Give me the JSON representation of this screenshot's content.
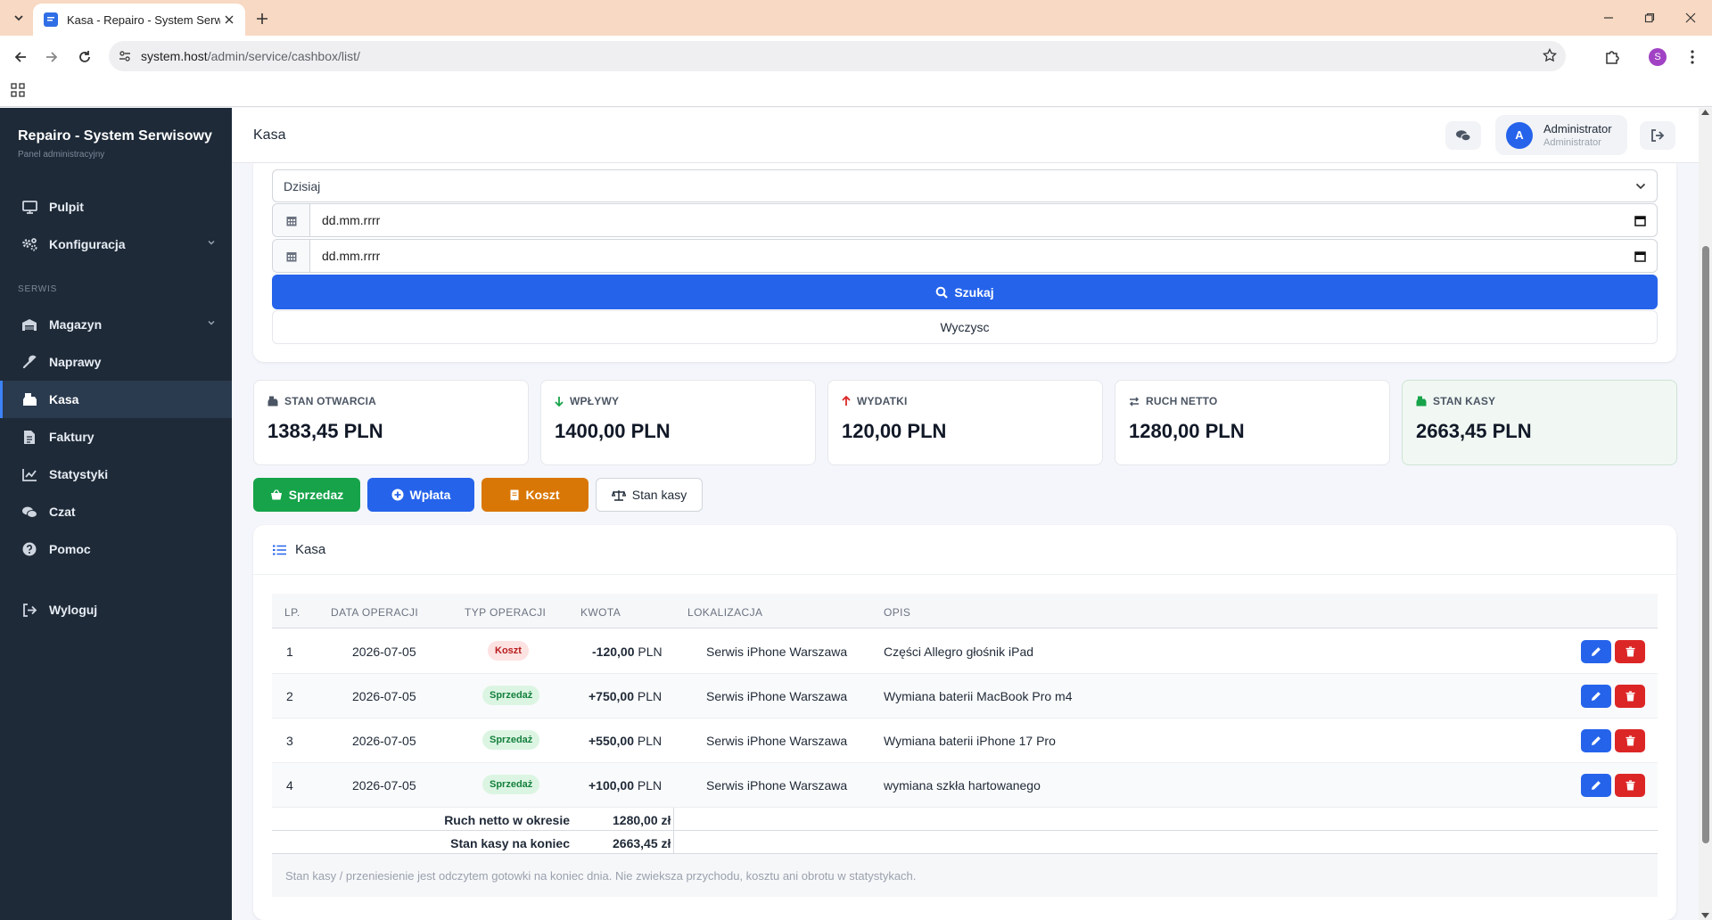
{
  "browser": {
    "tab_title": "Kasa - Repairo - System Serwisowy",
    "url_host": "system.host",
    "url_path": "/admin/service/cashbox/list/",
    "profile_initial": "S"
  },
  "sidebar": {
    "brand": "Repairo - System Serwisowy",
    "brand_sub": "Panel administracyjny",
    "section_label": "SERWIS",
    "items": [
      {
        "label": "Pulpit",
        "icon": "monitor-icon"
      },
      {
        "label": "Konfiguracja",
        "icon": "gears-icon"
      },
      {
        "label": "Magazyn",
        "icon": "warehouse-icon"
      },
      {
        "label": "Naprawy",
        "icon": "wrench-icon"
      },
      {
        "label": "Kasa",
        "icon": "cash-register-icon"
      },
      {
        "label": "Faktury",
        "icon": "invoice-icon"
      },
      {
        "label": "Statystyki",
        "icon": "chart-line-icon"
      },
      {
        "label": "Czat",
        "icon": "chat-icon"
      },
      {
        "label": "Pomoc",
        "icon": "question-icon"
      },
      {
        "label": "Wyloguj",
        "icon": "sign-out-icon"
      }
    ],
    "active": "Kasa"
  },
  "header": {
    "title": "Kasa",
    "user_initial": "A",
    "user_name": "Administrator",
    "user_role": "Administrator"
  },
  "filter": {
    "period_value": "Dzisiaj",
    "date_from": "dd.mm.rrrr",
    "date_to": "dd.mm.rrrr",
    "search_label": "Szukaj",
    "clear_label": "Wyczysc"
  },
  "stats": [
    {
      "label": "STAN OTWARCIA",
      "value": "1383,45 PLN",
      "icon": "cash-register-icon"
    },
    {
      "label": "WPŁYWY",
      "value": "1400,00 PLN",
      "icon": "arrow-down-icon"
    },
    {
      "label": "WYDATKI",
      "value": "120,00 PLN",
      "icon": "arrow-up-icon"
    },
    {
      "label": "RUCH NETTO",
      "value": "1280,00 PLN",
      "icon": "exchange-icon"
    },
    {
      "label": "STAN KASY",
      "value": "2663,45 PLN",
      "icon": "money-icon"
    }
  ],
  "actions": {
    "sale": "Sprzedaz",
    "deposit": "Wpłata",
    "cost": "Koszt",
    "balance": "Stan kasy"
  },
  "table": {
    "title": "Kasa",
    "columns": [
      "LP.",
      "DATA OPERACJI",
      "TYP OPERACJI",
      "KWOTA",
      "LOKALIZACJA",
      "OPIS"
    ],
    "rows": [
      {
        "lp": "1",
        "date": "2026-07-05",
        "type": "Koszt",
        "amount": "-120,00",
        "currency": "PLN",
        "location": "Serwis iPhone Warszawa",
        "desc": "Części Allegro głośnik iPad"
      },
      {
        "lp": "2",
        "date": "2026-07-05",
        "type": "Sprzedaż",
        "amount": "+750,00",
        "currency": "PLN",
        "location": "Serwis iPhone Warszawa",
        "desc": "Wymiana baterii MacBook Pro m4"
      },
      {
        "lp": "3",
        "date": "2026-07-05",
        "type": "Sprzedaż",
        "amount": "+550,00",
        "currency": "PLN",
        "location": "Serwis iPhone Warszawa",
        "desc": "Wymiana baterii iPhone 17 Pro"
      },
      {
        "lp": "4",
        "date": "2026-07-05",
        "type": "Sprzedaż",
        "amount": "+100,00",
        "currency": "PLN",
        "location": "Serwis iPhone Warszawa",
        "desc": "wymiana szkła hartowanego"
      }
    ],
    "summary": [
      {
        "label": "Ruch netto w okresie",
        "value": "1280,00 zł"
      },
      {
        "label": "Stan kasy na koniec",
        "value": "2663,45 zł"
      }
    ],
    "note": "Stan kasy / przeniesienie jest odczytem gotowki na koniec dnia. Nie zwieksza przychodu, kosztu ani obrotu w statystykach."
  },
  "colors": {
    "primary": "#2563eb",
    "success": "#16a34a",
    "warning": "#d97706",
    "danger": "#dc2626",
    "sidebar": "#1e2a38"
  }
}
